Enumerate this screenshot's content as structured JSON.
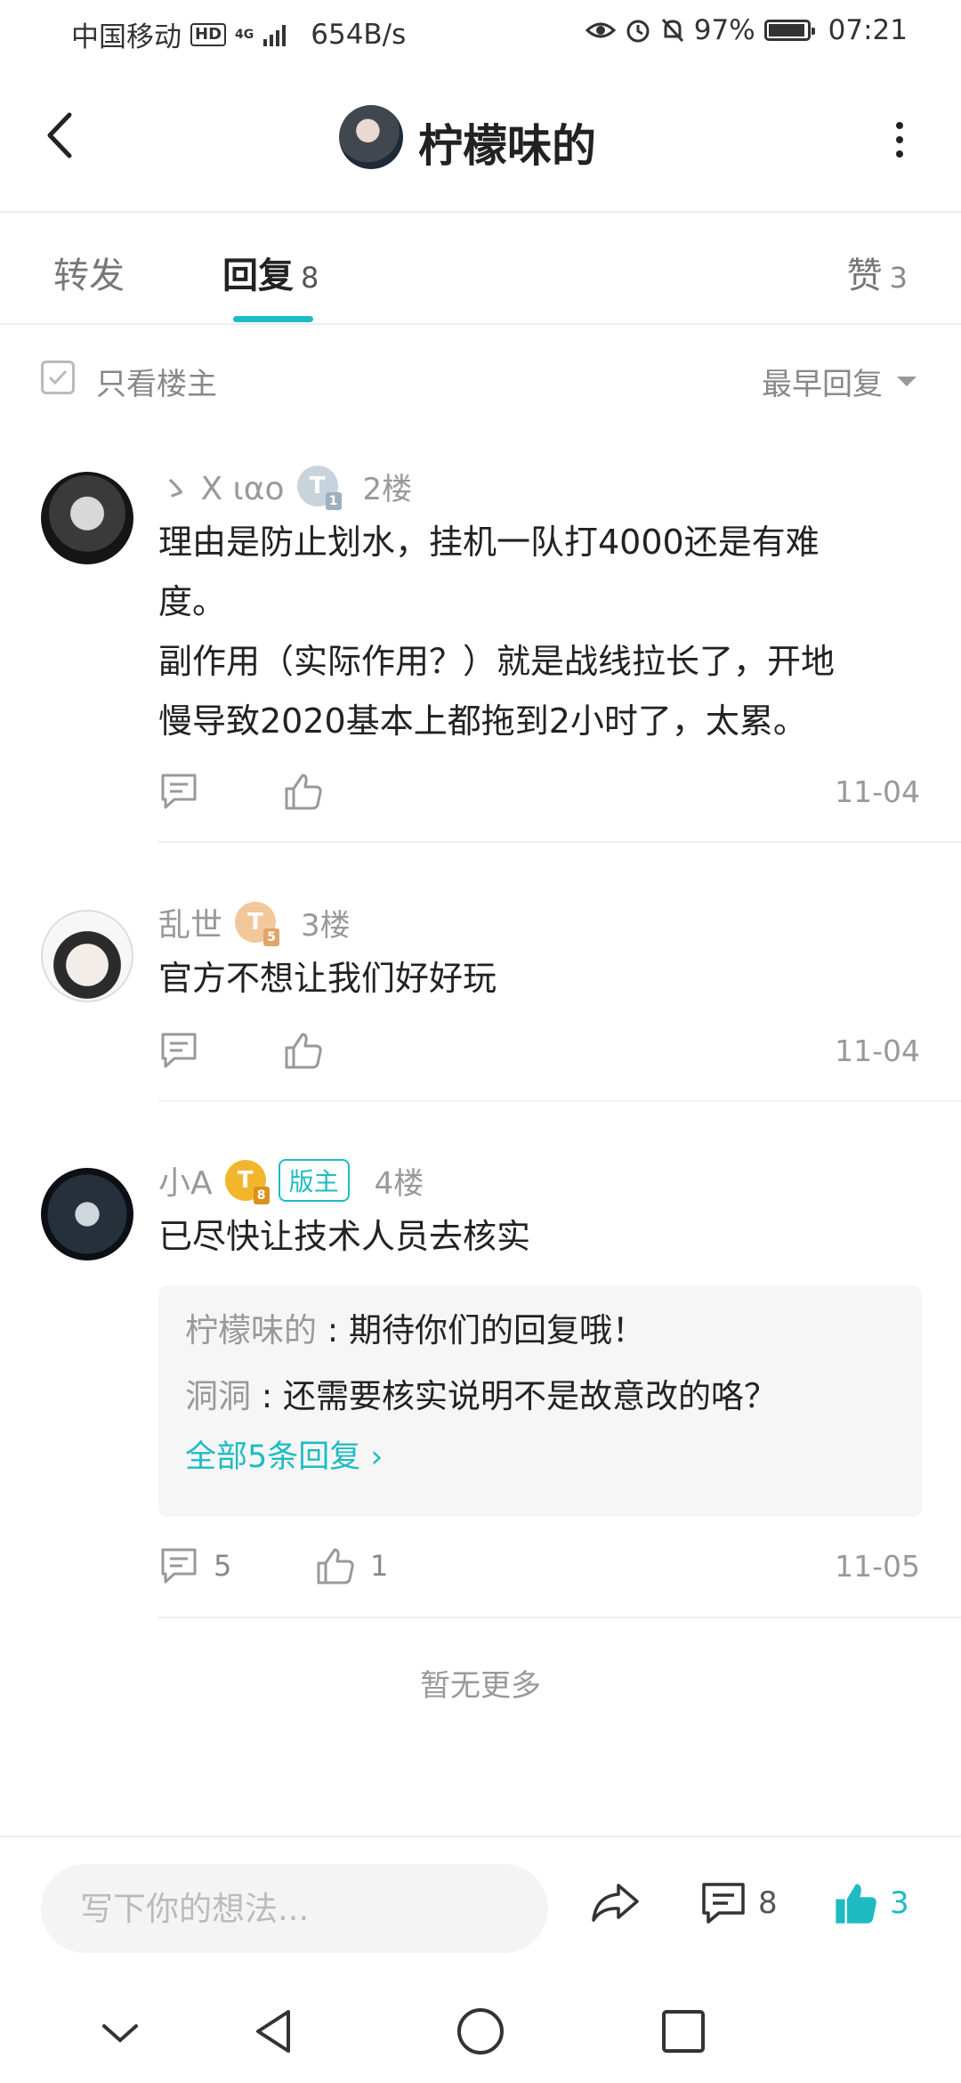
{
  "status_bar": {
    "carrier": "中国移动",
    "hd": "HD",
    "network": "4G",
    "speed": "654B/s",
    "battery": "97%",
    "battery_level": 0.97,
    "time": "07:21"
  },
  "header": {
    "title": "柠檬味的"
  },
  "tabs": [
    {
      "label": "转发",
      "count": ""
    },
    {
      "label": "回复",
      "count": "8"
    },
    {
      "label": "赞",
      "count": "3"
    }
  ],
  "filter": {
    "only_op_label": "只看楼主",
    "sort_label": "最早回复"
  },
  "replies": [
    {
      "user": "ゝ X ιαo",
      "level": "1",
      "floor": "2楼",
      "text_lines": [
        "理由是防止划水，挂机一队打4000还是有难",
        "度。",
        "副作用（实际作用？）就是战线拉长了，开地",
        "慢导致2020基本上都拖到2小时了，太累。"
      ],
      "date": "11-04",
      "comment_count": "",
      "like_count": ""
    },
    {
      "user": "乱世",
      "level": "5",
      "floor": "3楼",
      "text_lines": [
        "官方不想让我们好好玩"
      ],
      "date": "11-04",
      "comment_count": "",
      "like_count": ""
    },
    {
      "user": "小A",
      "level": "8",
      "badge": "版主",
      "floor": "4楼",
      "text_lines": [
        "已尽快让技术人员去核实"
      ],
      "sub_replies": [
        {
          "name": "柠檬味的",
          "sep": " : ",
          "text": "期待你们的回复哦！"
        },
        {
          "name": "洞洞",
          "sep": " : ",
          "text": "还需要核实说明不是故意改的咯？"
        }
      ],
      "more_link": "全部5条回复 ›",
      "date": "11-05",
      "comment_count": "5",
      "like_count": "1"
    }
  ],
  "no_more": "暂无更多",
  "bottom_bar": {
    "input_placeholder": "写下你的想法...",
    "comment_count": "8",
    "like_count": "3"
  },
  "colors": {
    "accent": "#1ebbc2",
    "text": "#222222",
    "muted": "#999999"
  }
}
